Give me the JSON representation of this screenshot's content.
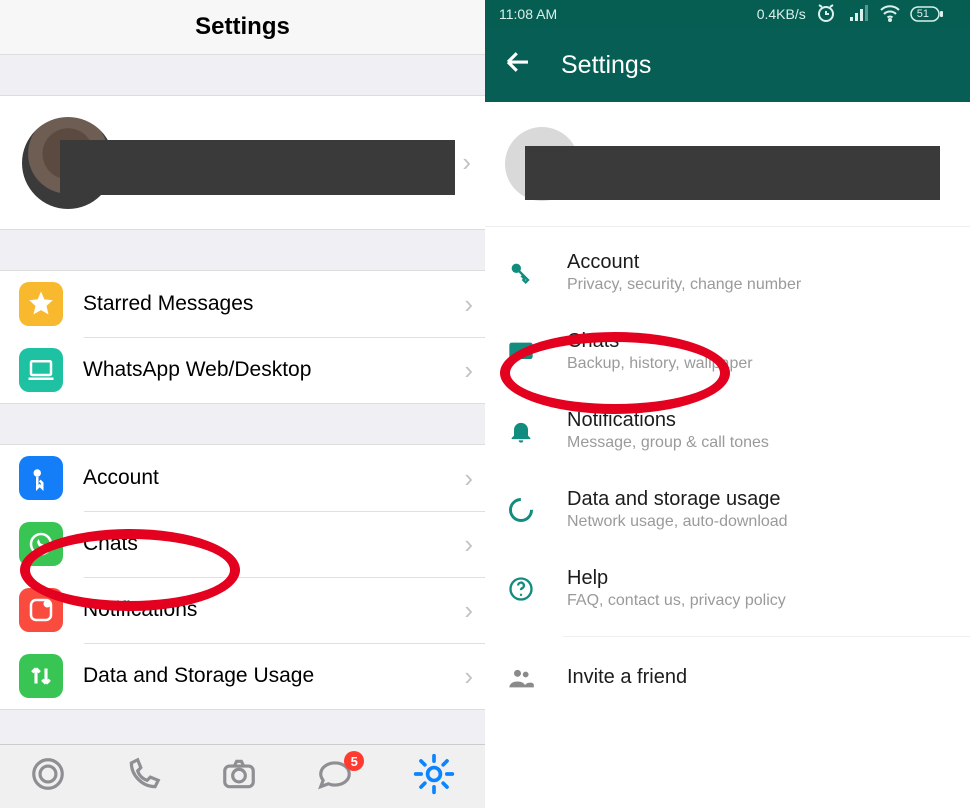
{
  "left": {
    "title": "Settings",
    "rows_group1": [
      {
        "label": "Starred Messages"
      },
      {
        "label": "WhatsApp Web/Desktop"
      }
    ],
    "rows_group2": [
      {
        "label": "Account"
      },
      {
        "label": "Chats"
      },
      {
        "label": "Notifications"
      },
      {
        "label": "Data and Storage Usage"
      }
    ],
    "chat_badge": "5"
  },
  "right": {
    "status": {
      "time": "11:08 AM",
      "speed": "0.4KB/s",
      "battery": "51"
    },
    "appbar": {
      "title": "Settings"
    },
    "rows": [
      {
        "title": "Account",
        "sub": "Privacy, security, change number"
      },
      {
        "title": "Chats",
        "sub": "Backup, history, wallpaper"
      },
      {
        "title": "Notifications",
        "sub": "Message, group & call tones"
      },
      {
        "title": "Data and storage usage",
        "sub": "Network usage, auto-download"
      },
      {
        "title": "Help",
        "sub": "FAQ, contact us, privacy policy"
      },
      {
        "title": "Invite a friend",
        "sub": ""
      }
    ]
  }
}
